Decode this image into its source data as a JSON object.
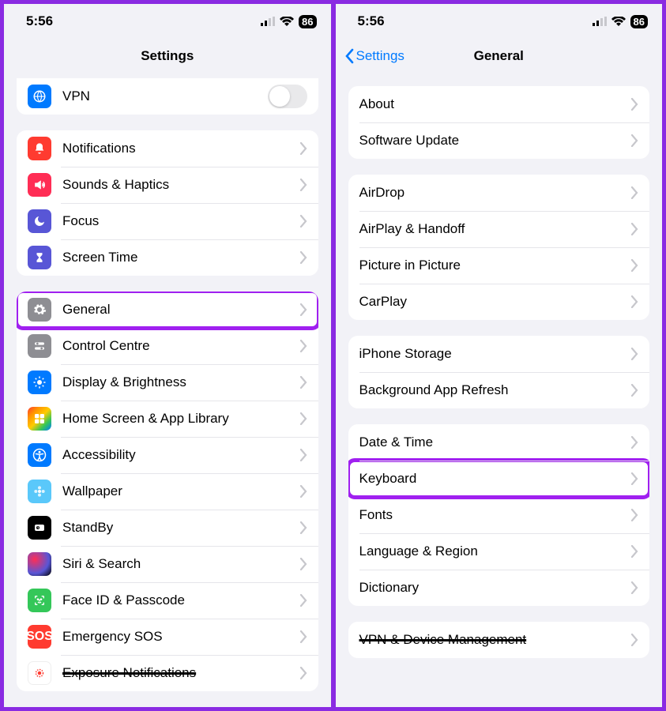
{
  "status": {
    "time": "5:56",
    "battery": "86"
  },
  "left": {
    "title": "Settings",
    "group0": {
      "vpn": "VPN"
    },
    "group1": {
      "notifications": "Notifications",
      "sounds": "Sounds & Haptics",
      "focus": "Focus",
      "screentime": "Screen Time"
    },
    "group2": {
      "general": "General",
      "controlcentre": "Control Centre",
      "display": "Display & Brightness",
      "homescreen": "Home Screen & App Library",
      "accessibility": "Accessibility",
      "wallpaper": "Wallpaper",
      "standby": "StandBy",
      "siri": "Siri & Search",
      "faceid": "Face ID & Passcode",
      "sos": "Emergency SOS",
      "exposure": "Exposure Notifications"
    }
  },
  "right": {
    "back": "Settings",
    "title": "General",
    "group1": {
      "about": "About",
      "software": "Software Update"
    },
    "group2": {
      "airdrop": "AirDrop",
      "airplay": "AirPlay & Handoff",
      "pip": "Picture in Picture",
      "carplay": "CarPlay"
    },
    "group3": {
      "storage": "iPhone Storage",
      "bgrefresh": "Background App Refresh"
    },
    "group4": {
      "datetime": "Date & Time",
      "keyboard": "Keyboard",
      "fonts": "Fonts",
      "language": "Language & Region",
      "dictionary": "Dictionary"
    },
    "group5": {
      "vpnmgmt": "VPN & Device Management"
    }
  }
}
